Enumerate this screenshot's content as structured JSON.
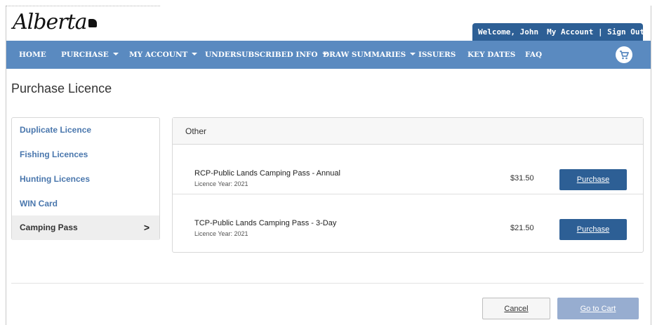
{
  "brand": {
    "logo_text": "Alberta"
  },
  "account_bar": {
    "welcome": "Welcome, John",
    "links": "My Account | Sign Out"
  },
  "nav": {
    "items": [
      {
        "label": "HOME",
        "dropdown": false
      },
      {
        "label": "PURCHASE",
        "dropdown": true
      },
      {
        "label": "MY ACCOUNT",
        "dropdown": true
      },
      {
        "label": "UNDERSUBSCRIBED INFO",
        "dropdown": true
      },
      {
        "label": "DRAW SUMMARIES",
        "dropdown": true
      },
      {
        "label": "ISSUERS",
        "dropdown": false
      },
      {
        "label": "KEY DATES",
        "dropdown": false
      },
      {
        "label": "FAQ",
        "dropdown": false
      }
    ],
    "cart_icon": "shopping-cart-icon"
  },
  "page": {
    "title": "Purchase Licence"
  },
  "sidebar": {
    "items": [
      {
        "label": "Duplicate Licence",
        "active": false
      },
      {
        "label": "Fishing Licences",
        "active": false
      },
      {
        "label": "Hunting Licences",
        "active": false
      },
      {
        "label": "WIN Card",
        "active": false
      },
      {
        "label": "Camping Pass",
        "active": true,
        "chevron": ">"
      }
    ]
  },
  "panel": {
    "heading": "Other",
    "products": [
      {
        "name": "RCP-Public Lands Camping Pass - Annual",
        "subtitle": "Licence Year: 2021",
        "price": "$31.50",
        "button": "Purchase"
      },
      {
        "name": "TCP-Public Lands Camping Pass - 3-Day",
        "subtitle": "Licence Year: 2021",
        "price": "$21.50",
        "button": "Purchase"
      }
    ]
  },
  "footer": {
    "cancel_label": "Cancel",
    "go_to_cart_label": "Go to Cart"
  },
  "colors": {
    "nav_bg": "#5a8ac0",
    "primary": "#2d5f95",
    "link": "#4a77ad",
    "disabled_button": "#97add0"
  }
}
